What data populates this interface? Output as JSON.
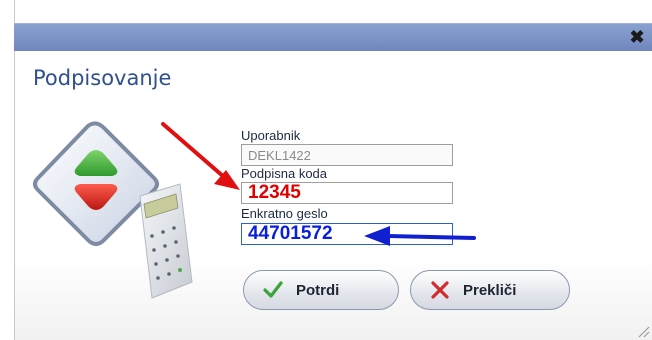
{
  "dialog": {
    "title": "Podpisovanje",
    "close_label": "✖"
  },
  "form": {
    "user_label": "Uporabnik",
    "user_value": "DEKL1422",
    "code_label": "Podpisna koda",
    "code_value": "12345",
    "otp_label": "Enkratno geslo",
    "otp_value": "44701572"
  },
  "buttons": {
    "confirm_label": "Potrdi",
    "cancel_label": "Prekliči"
  },
  "colors": {
    "titlebar": "#7b93c8",
    "title_text": "#2f4f8f",
    "code_text": "#e00000",
    "otp_text": "#0a1fd8",
    "arrow_red": "#e01010",
    "arrow_blue": "#1020d0"
  },
  "icons": [
    "close-icon",
    "check-icon",
    "x-icon",
    "signing-logo-icon",
    "calculator-token-icon"
  ]
}
